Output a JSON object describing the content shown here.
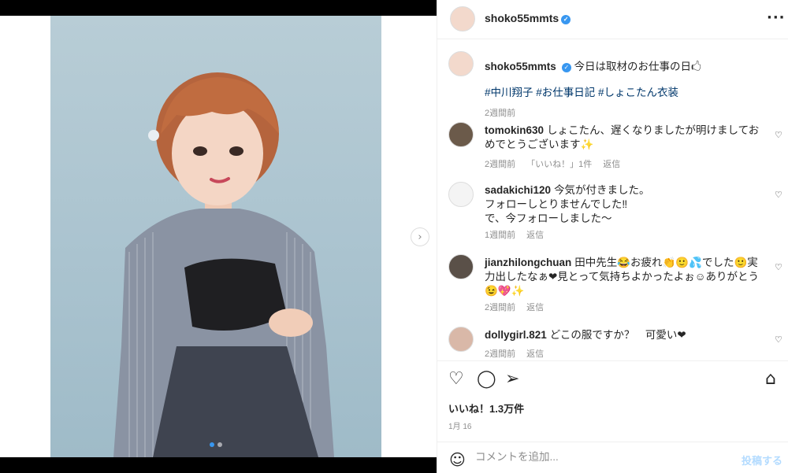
{
  "post": {
    "author": "shoko55mmts",
    "caption_text": "今日は取材のお仕事の日🖒",
    "hashtags": "#中川翔子 #お仕事日記 #しょこたん衣装",
    "caption_time": "2週間前",
    "likes": "いいね！1.3万件",
    "date": "1月 16"
  },
  "comments": [
    {
      "user": "tomokin630",
      "text": "しょこたん、遅くなりましたが明けましておめでとうございます✨",
      "time": "2週間前",
      "likes": "「いいね！」1件",
      "reply": "返信"
    },
    {
      "user": "sadakichi120",
      "text": "今気が付きました。\nフォローしとりませんでした‼\nで、今フォローしました〜",
      "time": "1週間前",
      "reply": "返信"
    },
    {
      "user": "jianzhilongchuan",
      "text": "田中先生😂お疲れ👏🙂💦でした🙂実力出したなぁ❤見とって気持ちよかったよぉ☺ありがとう😉💖✨",
      "time": "2週間前",
      "reply": "返信"
    },
    {
      "user": "dollygirl.821",
      "text": "どこの服ですか？　可愛い❤",
      "time": "2週間前",
      "reply": "返信"
    }
  ],
  "composer": {
    "placeholder": "コメントを追加...",
    "post_label": "投稿する"
  },
  "icons": {
    "more": "more-icon",
    "heart": "heart-icon",
    "comment": "comment-icon",
    "share": "share-icon",
    "bookmark": "bookmark-icon",
    "emoji": "emoji-icon",
    "next": "chevron-right-icon"
  },
  "colors": {
    "accent": "#3897f0",
    "hashtag": "#00376b",
    "post_disabled": "#b3dbff"
  }
}
